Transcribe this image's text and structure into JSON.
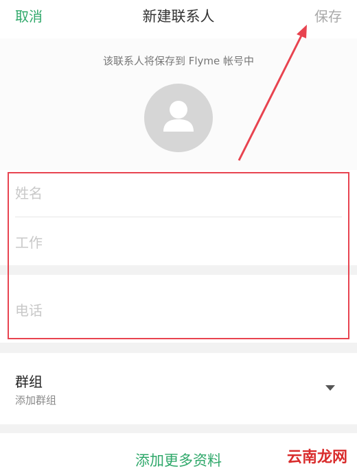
{
  "header": {
    "cancel_label": "取消",
    "title": "新建联系人",
    "save_label": "保存"
  },
  "notice": {
    "text": "该联系人将保存到 Flyme 帐号中"
  },
  "avatar": {
    "icon": "person-icon"
  },
  "form": {
    "name_placeholder": "姓名",
    "work_placeholder": "工作",
    "phone_placeholder": "电话"
  },
  "group": {
    "title": "群组",
    "subtitle": "添加群组"
  },
  "more": {
    "label": "添加更多资料"
  },
  "watermark": "云南龙网",
  "colors": {
    "accent": "#2fa86a",
    "annotation_red": "#e8434f",
    "disabled": "#a8a8a8"
  }
}
